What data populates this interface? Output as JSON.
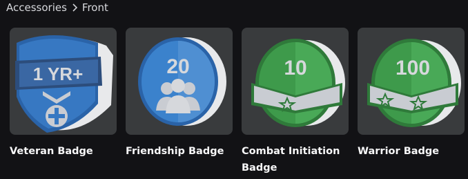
{
  "breadcrumb": {
    "parent": "Accessories",
    "current": "Front"
  },
  "items": [
    {
      "name": "Veteran Badge",
      "badge_text": "1 YR+",
      "icon": "badge-shield-cross-icon",
      "color": "#2d6fb8"
    },
    {
      "name": "Friendship Badge",
      "badge_text": "20",
      "icon": "badge-friends-icon",
      "color": "#3a80c9"
    },
    {
      "name": "Combat Initiation Badge",
      "badge_text": "10",
      "icon": "badge-stars-green-icon",
      "color": "#3b8a46"
    },
    {
      "name": "Warrior Badge",
      "badge_text": "100",
      "icon": "badge-stars-green-icon",
      "color": "#3b8a46"
    }
  ],
  "colors": {
    "background": "#121215",
    "card": "#393b3d",
    "text": "#f7f7f8"
  }
}
